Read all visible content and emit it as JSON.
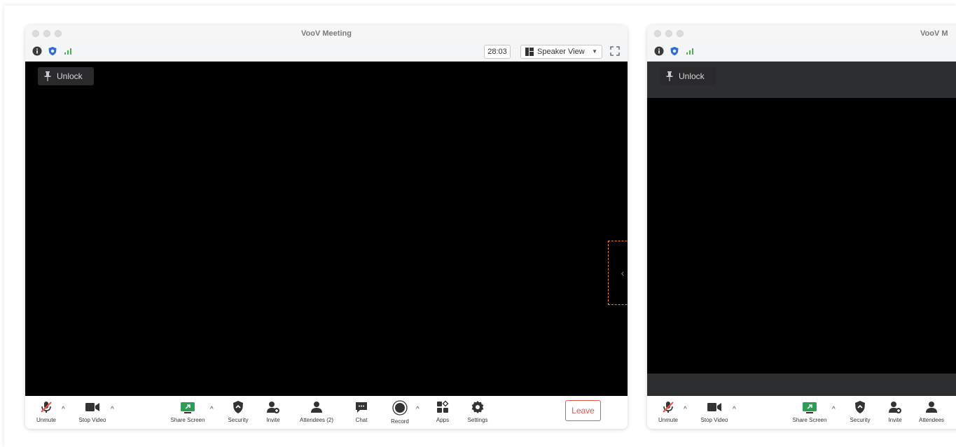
{
  "windows": [
    {
      "title": "VooV Meeting",
      "timer": "28:03",
      "view_mode": "Speaker View",
      "unlock_label": "Unlock",
      "toolbar": {
        "unmute": "Unmute",
        "stop_video": "Stop Video",
        "share_screen": "Share Screen",
        "security": "Security",
        "invite": "Invite",
        "attendees": "Attendees (2)",
        "chat": "Chat",
        "record": "Record",
        "apps": "Apps",
        "settings": "Settings",
        "leave": "Leave"
      }
    },
    {
      "title": "VooV M",
      "unlock_label": "Unlock",
      "toolbar": {
        "unmute": "Unmute",
        "stop_video": "Stop Video",
        "share_screen": "Share Screen",
        "security": "Security",
        "invite": "Invite",
        "attendees": "Attendees"
      }
    }
  ],
  "colors": {
    "shield": "#2f6bd8",
    "signal": "#4cb050",
    "share_green": "#2e9e55",
    "leave": "#e2584d",
    "highlight": "#e8883a"
  },
  "icons": [
    "info-icon",
    "shield-icon",
    "signal-icon",
    "speaker-view-icon",
    "fullscreen-icon",
    "pin-icon",
    "chevron-left-icon",
    "mic-muted-icon",
    "camera-icon",
    "share-screen-icon",
    "security-icon",
    "invite-icon",
    "attendees-icon",
    "chat-icon",
    "record-icon",
    "apps-icon",
    "settings-icon"
  ]
}
